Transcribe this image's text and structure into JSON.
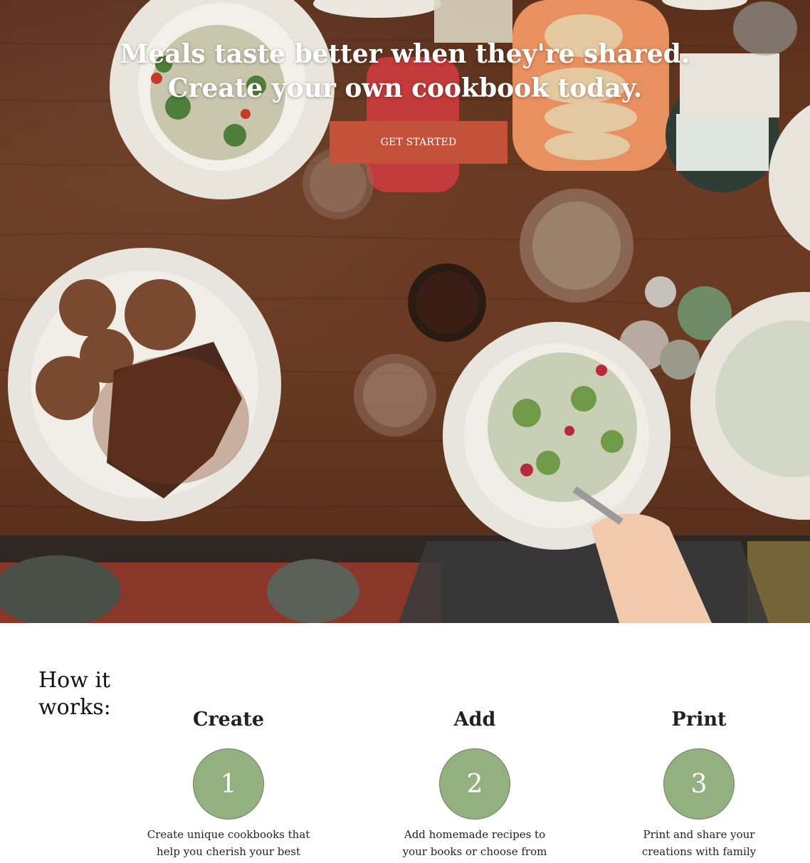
{
  "hero": {
    "title_line1": "Meals taste better when they're shared.",
    "title_line2": "Create your own cookbook today.",
    "cta_label": "GET STARTED"
  },
  "how_it_works": {
    "heading": "How it works:",
    "steps": [
      {
        "title": "Create",
        "number": "1",
        "description": "Create unique cookbooks that help you cherish your best cooking memories."
      },
      {
        "title": "Add",
        "number": "2",
        "description": "Add homemade recipes to your books or choose from hundreds of our recipes."
      },
      {
        "title": "Print",
        "number": "3",
        "description": "Print and share your creations with family and friends."
      }
    ]
  },
  "colors": {
    "accent": "#c4513a",
    "step_circle": "#93b07f",
    "table_wood": "#6a3a22"
  }
}
